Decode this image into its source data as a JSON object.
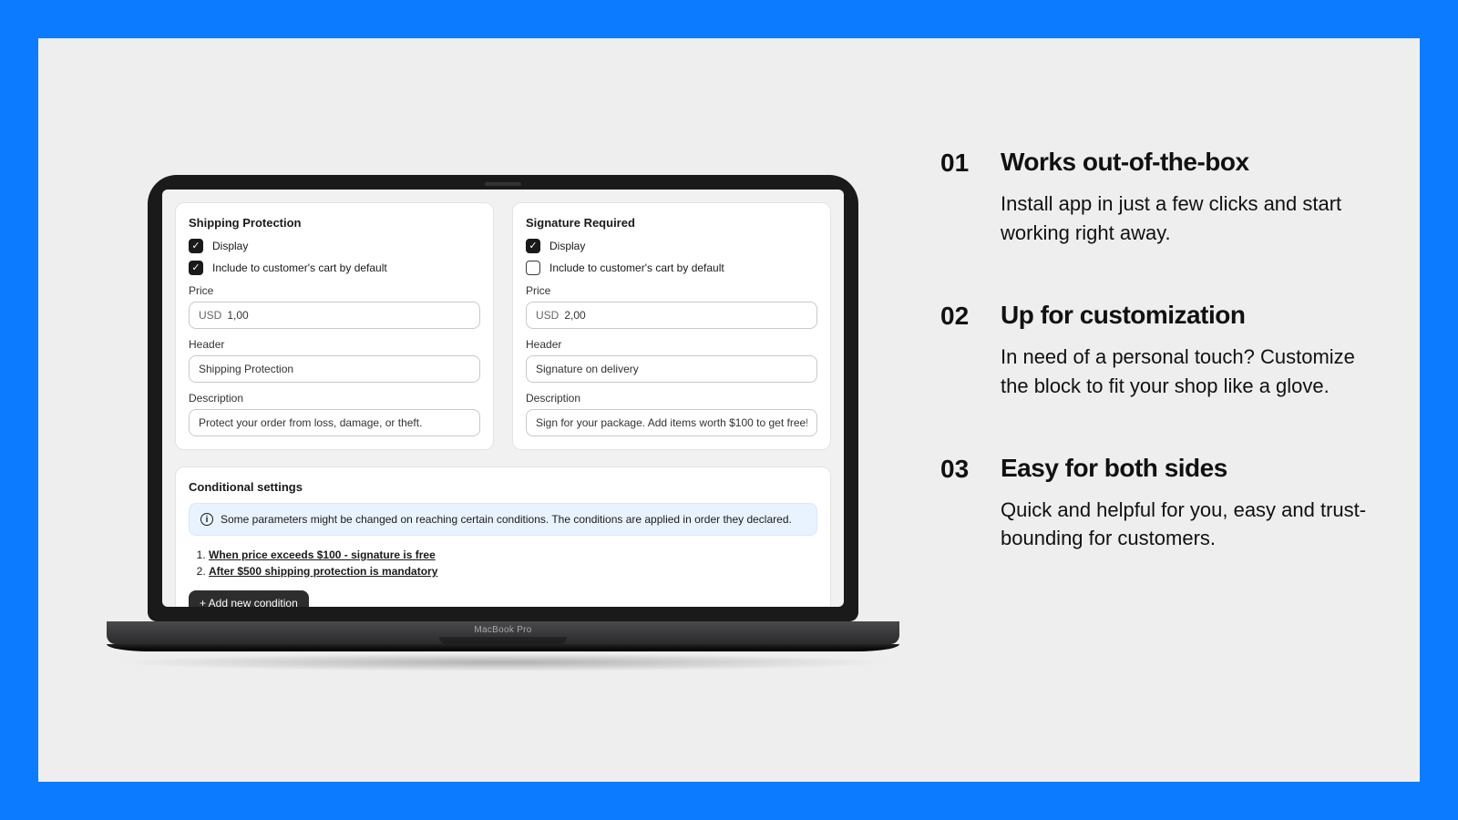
{
  "device_label": "MacBook Pro",
  "cards": {
    "shipping": {
      "title": "Shipping Protection",
      "display_label": "Display",
      "display_checked": true,
      "include_label": "Include to customer's cart by default",
      "include_checked": true,
      "price_label": "Price",
      "currency": "USD",
      "price_value": "1,00",
      "header_label": "Header",
      "header_value": "Shipping Protection",
      "desc_label": "Description",
      "desc_value": "Protect your order from loss, damage, or theft."
    },
    "signature": {
      "title": "Signature Required",
      "display_label": "Display",
      "display_checked": true,
      "include_label": "Include to customer's cart by default",
      "include_checked": false,
      "price_label": "Price",
      "currency": "USD",
      "price_value": "2,00",
      "header_label": "Header",
      "header_value": "Signature on delivery",
      "desc_label": "Description",
      "desc_value": "Sign for your package. Add items worth $100 to get free!"
    }
  },
  "conditional": {
    "title": "Conditional settings",
    "info": "Some parameters might be changed on reaching certain conditions. The conditions are applied in order they declared.",
    "rules": [
      "When price exceeds $100 - signature is free",
      "After $500 shipping protection is mandatory"
    ],
    "add_button": "+ Add new condition"
  },
  "features": [
    {
      "num": "01",
      "title": "Works out-of-the-box",
      "desc": "Install app in just a few clicks and start working right away."
    },
    {
      "num": "02",
      "title": "Up for customization",
      "desc": "In need of a personal touch? Customize the block to fit your shop like a glove."
    },
    {
      "num": "03",
      "title": "Easy for both sides",
      "desc": "Quick and helpful for you, easy and trust-bounding for customers."
    }
  ]
}
